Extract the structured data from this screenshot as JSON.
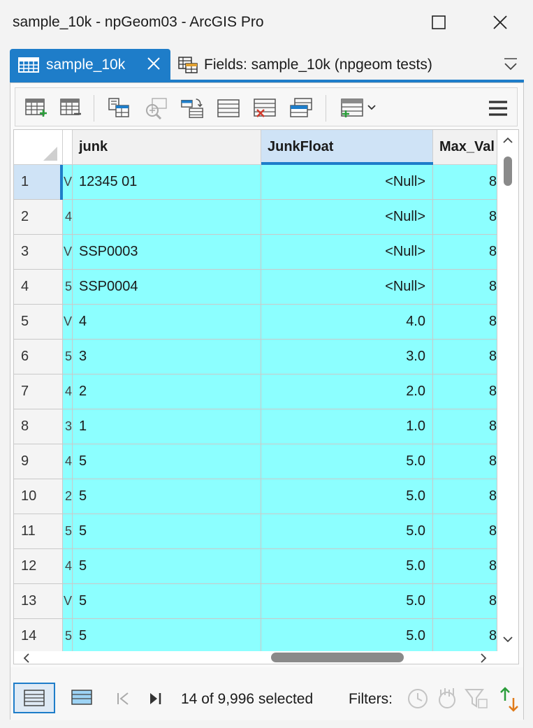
{
  "window": {
    "title": "sample_10k - npGeom03 - ArcGIS Pro",
    "maximize_glyph": "☐",
    "close_glyph": "✕"
  },
  "tabs": [
    {
      "label": "sample_10k",
      "icon": "table-icon",
      "active": true
    },
    {
      "label": "Fields: sample_10k (npgeom tests)",
      "icon": "fields-icon",
      "active": false
    }
  ],
  "toolbar": {
    "buttons": [
      "add-field-icon",
      "delete-field-icon",
      "calculate-field-icon",
      "zoom-to-icon",
      "switch-selection-icon",
      "select-all-icon",
      "clear-selection-icon",
      "copy-selection-icon",
      "table-options-icon",
      "menu-icon"
    ]
  },
  "columns": {
    "junk": "junk",
    "junkfloat": "JunkFloat",
    "maxval": "Max_Val"
  },
  "rows": [
    {
      "num": "1",
      "strip": "V",
      "junk": "12345 01",
      "jf": "<Null>",
      "max": "8"
    },
    {
      "num": "2",
      "strip": "4",
      "junk": "",
      "jf": "<Null>",
      "max": "8"
    },
    {
      "num": "3",
      "strip": "V",
      "junk": "SSP0003",
      "jf": "<Null>",
      "max": "8"
    },
    {
      "num": "4",
      "strip": "5",
      "junk": "SSP0004",
      "jf": "<Null>",
      "max": "8"
    },
    {
      "num": "5",
      "strip": "V",
      "junk": "4",
      "jf": "4.0",
      "max": "8"
    },
    {
      "num": "6",
      "strip": "5",
      "junk": "3",
      "jf": "3.0",
      "max": "8"
    },
    {
      "num": "7",
      "strip": "4",
      "junk": "2",
      "jf": "2.0",
      "max": "8"
    },
    {
      "num": "8",
      "strip": "3",
      "junk": "1",
      "jf": "1.0",
      "max": "8"
    },
    {
      "num": "9",
      "strip": "4",
      "junk": "5",
      "jf": "5.0",
      "max": "8"
    },
    {
      "num": "10",
      "strip": "2",
      "junk": "5",
      "jf": "5.0",
      "max": "8"
    },
    {
      "num": "11",
      "strip": "5",
      "junk": "5",
      "jf": "5.0",
      "max": "8"
    },
    {
      "num": "12",
      "strip": "4",
      "junk": "5",
      "jf": "5.0",
      "max": "8"
    },
    {
      "num": "13",
      "strip": "V",
      "junk": "5",
      "jf": "5.0",
      "max": "8"
    },
    {
      "num": "14",
      "strip": "5",
      "junk": "5",
      "jf": "5.0",
      "max": "8"
    }
  ],
  "status": {
    "selection_text": "14 of 9,996 selected",
    "filters_label": "Filters:"
  },
  "colors": {
    "accent": "#1e7dc9",
    "selected_cell": "#8cffff",
    "header_active": "#cfe3f6"
  }
}
